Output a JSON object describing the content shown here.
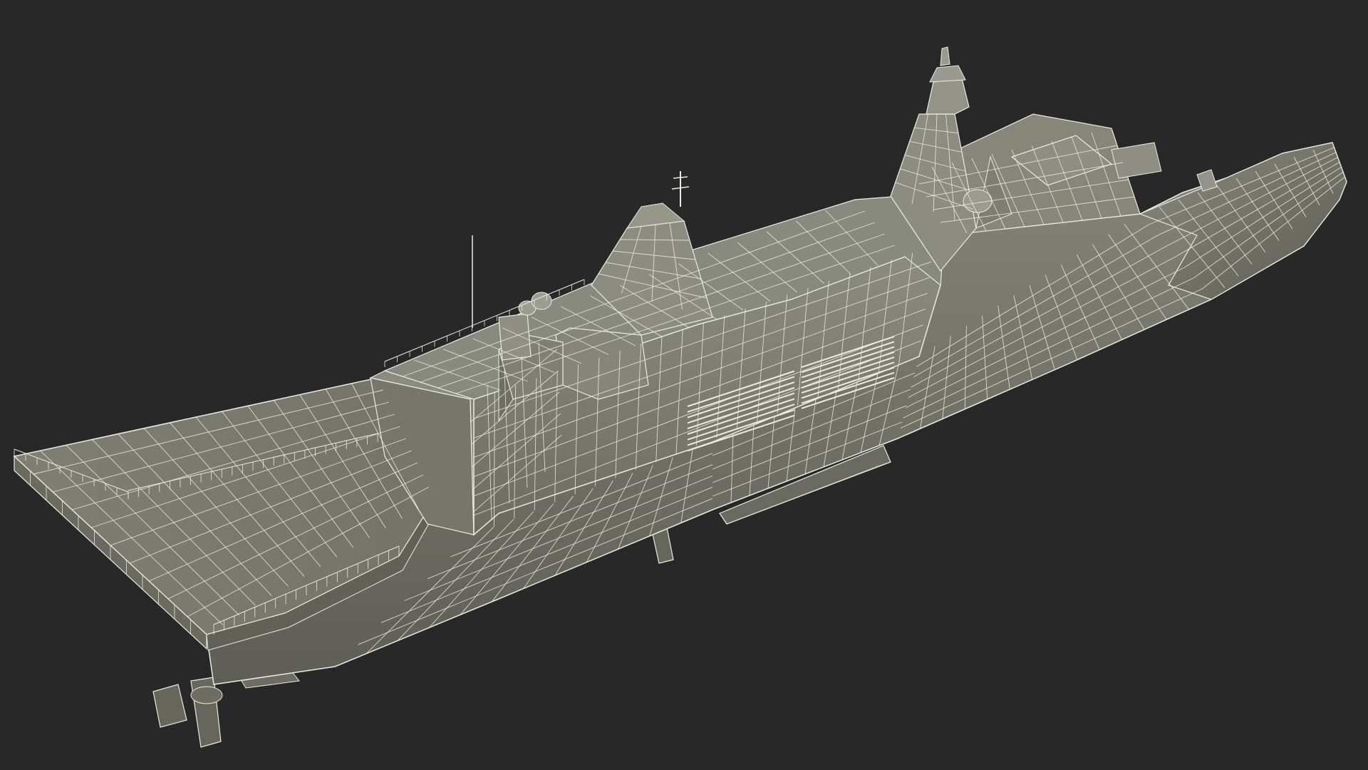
{
  "viewport": {
    "background_color": "#282828",
    "model": {
      "subject": "naval frigate",
      "render_style": "wireframe over shaded clay",
      "surface_color": "#7c7c70",
      "surface_dark_color": "#5f5f56",
      "surface_light_color": "#8e8e82",
      "wire_color": "#ecebdf"
    }
  }
}
